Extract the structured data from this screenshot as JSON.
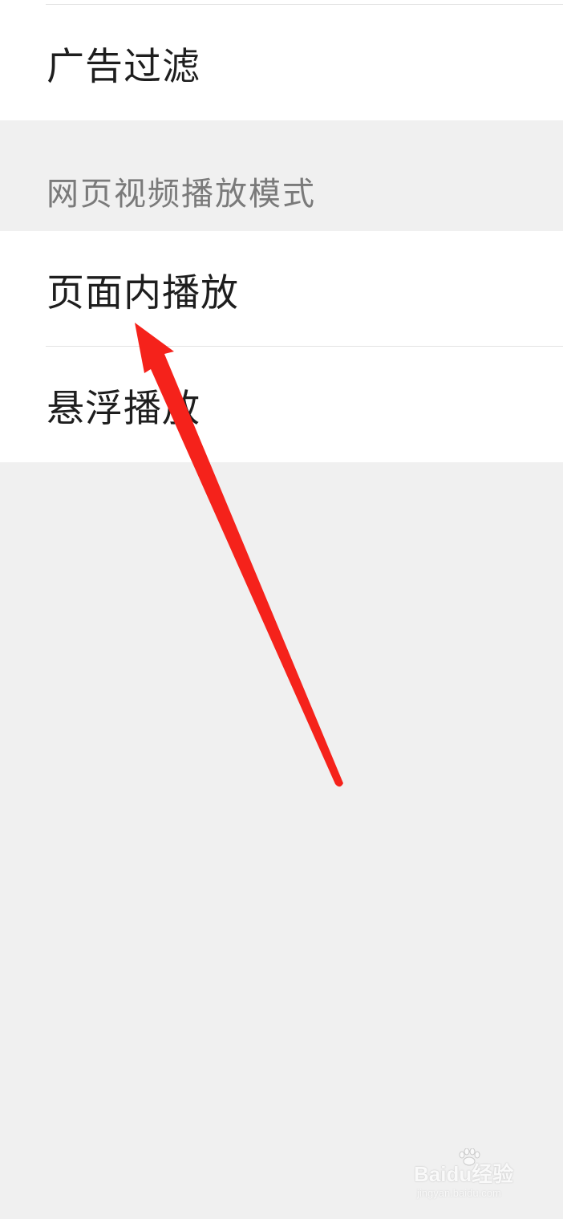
{
  "settings": {
    "ad_filter_label": "广告过滤",
    "video_mode_section_title": "网页视频播放模式",
    "video_mode_options": [
      {
        "label": "页面内播放"
      },
      {
        "label": "悬浮播放"
      }
    ]
  },
  "annotation": {
    "arrow_color": "#f5221b"
  },
  "watermark": {
    "brand": "Baidu经验",
    "url": "jingyan.baidu.com"
  }
}
